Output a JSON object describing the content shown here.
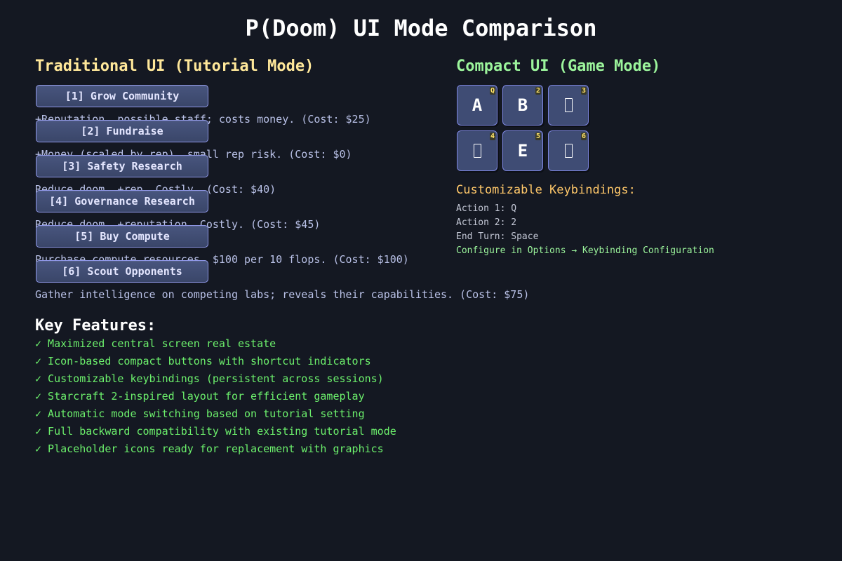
{
  "title": "P(Doom) UI Mode Comparison",
  "traditional": {
    "heading": "Traditional UI (Tutorial Mode)",
    "actions": [
      {
        "label": "[1] Grow Community",
        "description": "+Reputation, possible staff; costs money. (Cost: $25)"
      },
      {
        "label": "[2] Fundraise",
        "description": "+Money (scaled by rep), small rep risk. (Cost: $0)"
      },
      {
        "label": "[3] Safety Research",
        "description": "Reduce doom, +rep. Costly. (Cost: $40)"
      },
      {
        "label": "[4] Governance Research",
        "description": "Reduce doom, +reputation. Costly. (Cost: $45)"
      },
      {
        "label": "[5] Buy Compute",
        "description": "Purchase compute resources. $100 per 10 flops. (Cost: $100)"
      },
      {
        "label": "[6] Scout Opponents",
        "description": "Gather intelligence on competing labs; reveals their capabilities. (Cost: $75)"
      }
    ]
  },
  "compact": {
    "heading": "Compact UI (Game Mode)",
    "buttons": [
      {
        "glyph": "A",
        "key": "Q",
        "icon": "letter-a-icon"
      },
      {
        "glyph": "B",
        "key": "2",
        "icon": "letter-b-icon"
      },
      {
        "glyph": "",
        "key": "3",
        "icon": "missing-glyph-icon"
      },
      {
        "glyph": "",
        "key": "4",
        "icon": "missing-glyph-icon"
      },
      {
        "glyph": "E",
        "key": "5",
        "icon": "letter-e-icon"
      },
      {
        "glyph": "",
        "key": "6",
        "icon": "missing-glyph-icon"
      }
    ],
    "keybindings": {
      "heading": "Customizable Keybindings:",
      "lines": [
        "Action 1: Q",
        "Action 2: 2",
        "End Turn: Space"
      ],
      "config": "Configure in Options → Keybinding Configuration"
    }
  },
  "features": {
    "heading": "Key Features:",
    "items": [
      "✓ Maximized central screen real estate",
      "✓ Icon-based compact buttons with shortcut indicators",
      "✓ Customizable keybindings (persistent across sessions)",
      "✓ Starcraft 2-inspired layout for efficient gameplay",
      "✓ Automatic mode switching based on tutorial setting",
      "✓ Full backward compatibility with existing tutorial mode",
      "✓ Placeholder icons ready for replacement with graphics"
    ]
  },
  "colors": {
    "background": "#141822",
    "button_border": "#9098e8",
    "traditional_heading": "#ffe89a",
    "compact_heading": "#9cf59c",
    "keybinding_heading": "#ffc86a",
    "feature_text": "#6cf06c",
    "shortcut_badge": "#ffe46a"
  }
}
